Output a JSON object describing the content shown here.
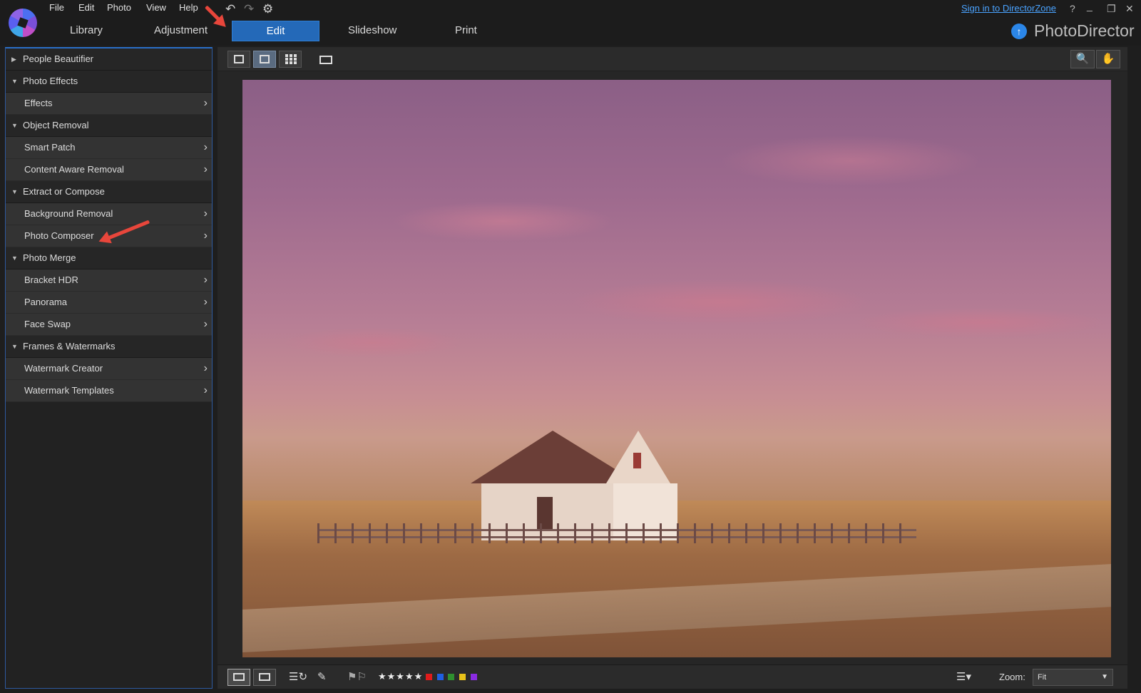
{
  "menu": {
    "file": "File",
    "edit": "Edit",
    "photo": "Photo",
    "view": "View",
    "help": "Help"
  },
  "tabs": {
    "library": "Library",
    "adjustment": "Adjustment",
    "edit": "Edit",
    "slideshow": "Slideshow",
    "print": "Print"
  },
  "signin": "Sign in to DirectorZone",
  "window_controls": {
    "help": "?",
    "minimize": "_",
    "restore": "❐",
    "close": "✕"
  },
  "brand": {
    "badge": "↑",
    "name": "PhotoDirector"
  },
  "panel": {
    "people_beautifier": "People Beautifier",
    "photo_effects": "Photo Effects",
    "effects": "Effects",
    "object_removal": "Object Removal",
    "smart_patch": "Smart Patch",
    "content_aware_removal": "Content Aware Removal",
    "extract_or_compose": "Extract or Compose",
    "background_removal": "Background Removal",
    "photo_composer": "Photo Composer",
    "photo_merge": "Photo Merge",
    "bracket_hdr": "Bracket HDR",
    "panorama": "Panorama",
    "face_swap": "Face Swap",
    "frames_watermarks": "Frames & Watermarks",
    "watermark_creator": "Watermark Creator",
    "watermark_templates": "Watermark Templates"
  },
  "glyphs": {
    "collapsed": "▶",
    "expanded": "▼",
    "chevron": "›",
    "undo": "↶",
    "redo": "↷",
    "settings": "⚙",
    "search": "🔍",
    "hand": "✋",
    "stars": "★★★★★",
    "caret": "▼"
  },
  "zoom": {
    "label": "Zoom:",
    "value": "Fit"
  },
  "color_labels": [
    "#e01b1b",
    "#1f5fe0",
    "#2f8f2f",
    "#e8c21a",
    "#8a2be2"
  ],
  "accent": "#2469b8"
}
